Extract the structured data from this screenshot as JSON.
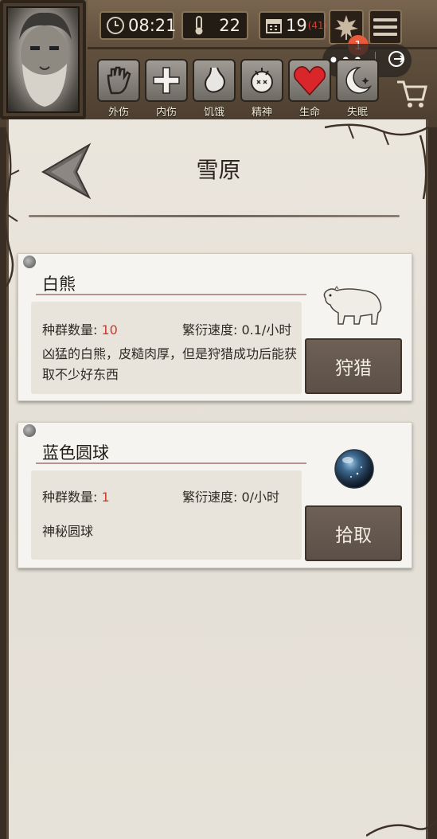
{
  "hud": {
    "time": "08:21",
    "temperature": "22",
    "day": "19",
    "day_sub": "(41)",
    "notification_count": "1",
    "status_bars": [
      {
        "label": "外伤",
        "icon": "hand-icon"
      },
      {
        "label": "内伤",
        "icon": "cross-icon"
      },
      {
        "label": "饥饿",
        "icon": "stomach-icon"
      },
      {
        "label": "精神",
        "icon": "head-icon"
      },
      {
        "label": "生命",
        "icon": "heart-icon"
      },
      {
        "label": "失眠",
        "icon": "moon-icon"
      }
    ]
  },
  "page": {
    "title": "雪原"
  },
  "creatures": [
    {
      "name": "白熊",
      "population_label": "种群数量: ",
      "population": "10",
      "speed_text": "繁衍速度: 0.1/小时",
      "description": "凶猛的白熊，皮糙肉厚，但是狩猎成功后能获取不少好东西",
      "action": "狩猎",
      "icon": "polar-bear-icon"
    },
    {
      "name": "蓝色圆球",
      "population_label": "种群数量: ",
      "population": "1",
      "speed_text": "繁衍速度: 0/小时",
      "description": "神秘圆球",
      "action": "拾取",
      "icon": "blue-orb-icon"
    }
  ],
  "colors": {
    "accent_red": "#d0362a",
    "badge": "#e85a3c",
    "heart": "#d8262a"
  }
}
